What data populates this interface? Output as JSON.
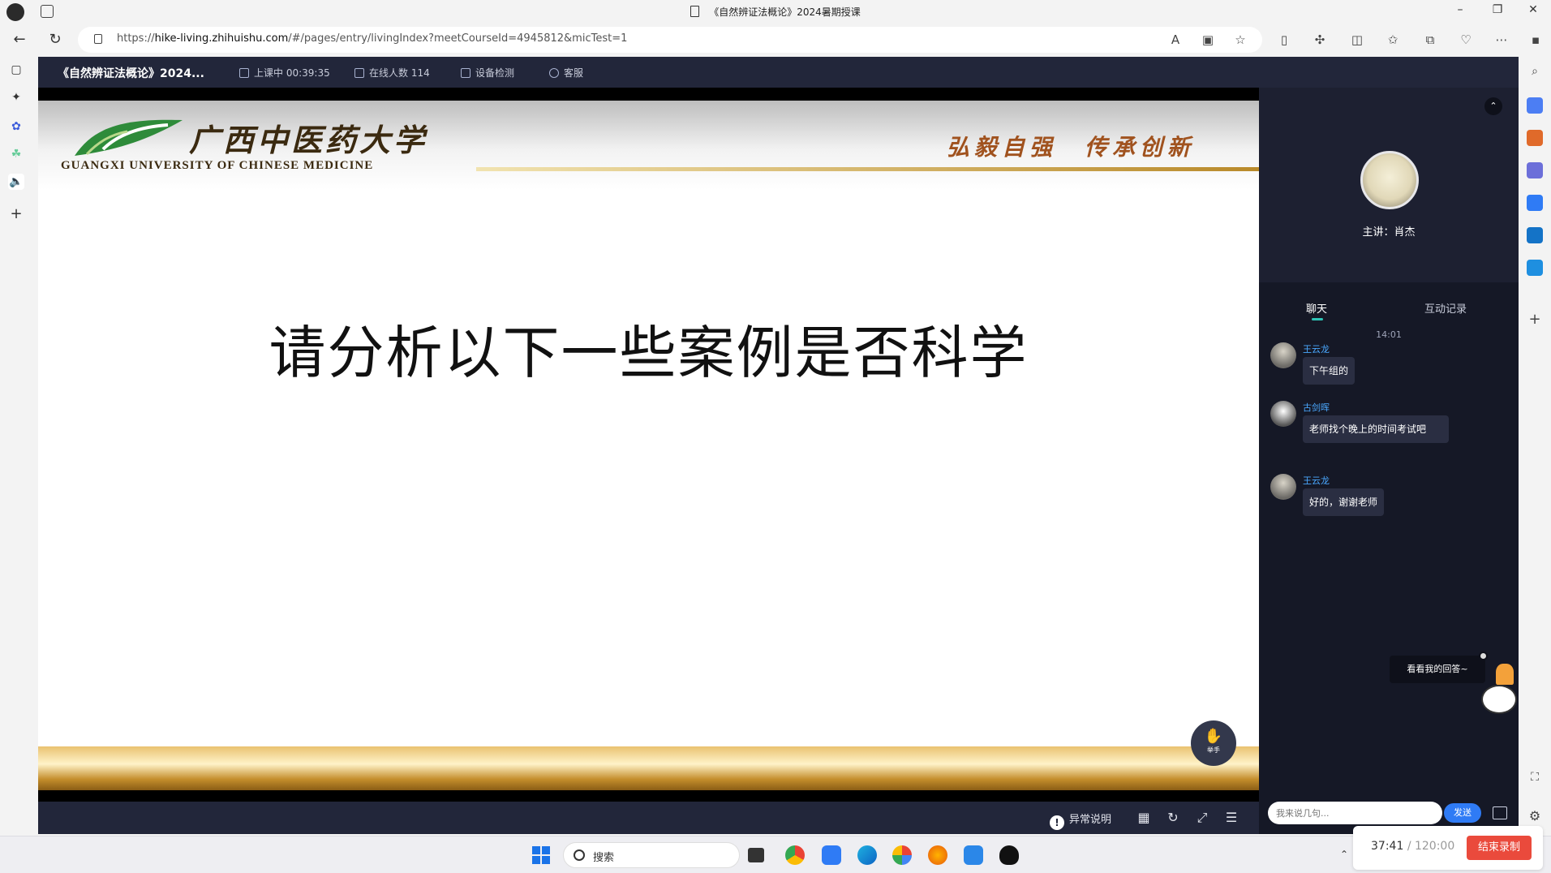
{
  "browser": {
    "window_title": "《自然辨证法概论》2024暑期授课",
    "url_prefix": "https://",
    "url_host": "hike-living.zhihuishu.com",
    "url_path": "/#/pages/entry/livingIndex?meetCourseId=4945812&micTest=1"
  },
  "topbar": {
    "course_title": "《自然辨证法概论》2024...",
    "status_label": "上课中 00:39:35",
    "online_label": "在线人数 114",
    "device_check": "设备检测",
    "service": "客服"
  },
  "slide": {
    "university_cn": "广西中医药大学",
    "university_en": "GUANGXI UNIVERSITY OF CHINESE MEDICINE",
    "motto": "弘毅自强　传承创新",
    "main_text": "请分析以下一些案例是否科学"
  },
  "hand_button": {
    "icon": "hand-icon",
    "label": "举手"
  },
  "bottombar": {
    "anomaly_label": "异常说明"
  },
  "right_panel": {
    "lecturer": "主讲：肖杰",
    "tabs": [
      "聊天",
      "互动记录"
    ],
    "active_tab": "聊天",
    "chat_time": "14:01",
    "messages": [
      {
        "name": "王云龙",
        "text": "下午组的"
      },
      {
        "name": "古剑晖",
        "text": "老师找个晚上的时间考试吧"
      },
      {
        "name": "王云龙",
        "text": "好的，谢谢老师"
      }
    ],
    "popup": "看看我的回答~",
    "input_placeholder": "我来说几句...",
    "send_label": "发送"
  },
  "taskbar": {
    "search_label": "搜索"
  },
  "recording": {
    "elapsed": "37:41",
    "total": "/ 120:00",
    "end_label": "结束录制"
  },
  "colors": {
    "accent_blue": "#2f7bf5",
    "chat_name": "#4aa8ff",
    "end_button": "#ea4a3c",
    "app_bg": "#1b1d2a",
    "tab_indicator": "#2ec4b6"
  }
}
